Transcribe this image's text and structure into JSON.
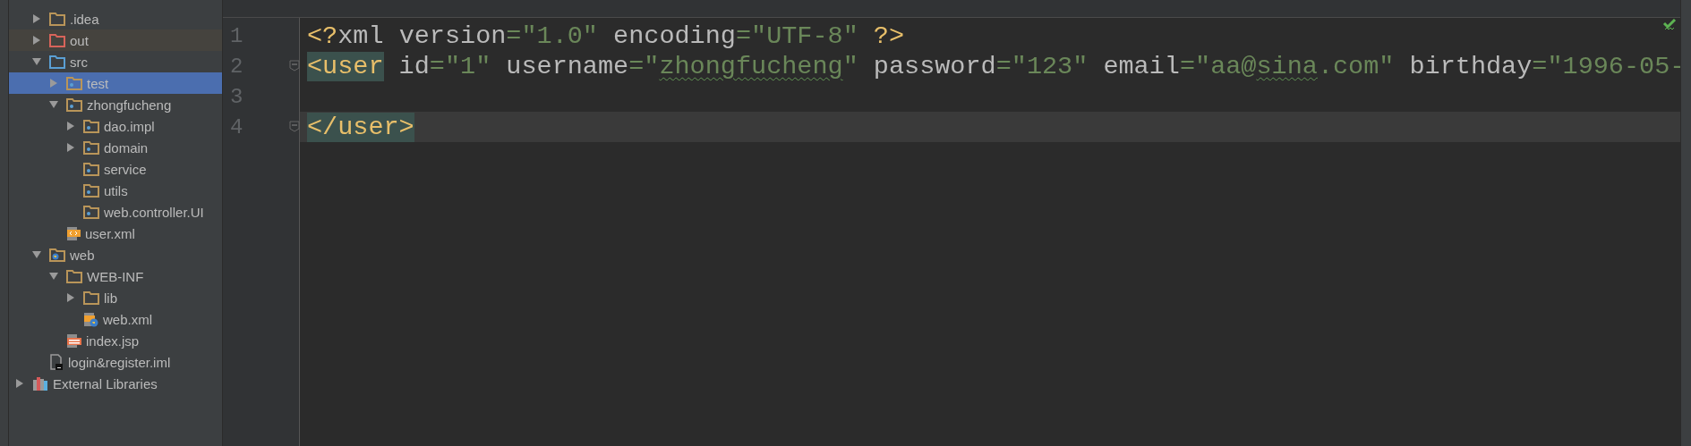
{
  "project_tree": {
    "module_items": [
      {
        "label": ".idea",
        "kind": "folder",
        "expanded": false,
        "selected": false
      },
      {
        "label": "out",
        "kind": "excluded_folder",
        "expanded": false,
        "selected": false
      },
      {
        "label": "src",
        "kind": "source_folder",
        "expanded": true,
        "selected": false,
        "children": [
          {
            "label": "test",
            "kind": "package",
            "expanded": false,
            "selected": true
          },
          {
            "label": "zhongfucheng",
            "kind": "package",
            "expanded": true,
            "selected": false,
            "children": [
              {
                "label": "dao.impl",
                "kind": "package",
                "expanded": false,
                "selected": false
              },
              {
                "label": "domain",
                "kind": "package",
                "expanded": false,
                "selected": false
              },
              {
                "label": "service",
                "kind": "package",
                "selected": false
              },
              {
                "label": "utils",
                "kind": "package",
                "selected": false
              },
              {
                "label": "web.controller.UI",
                "kind": "package",
                "selected": false
              }
            ]
          },
          {
            "label": "user.xml",
            "kind": "xml_file",
            "selected": false
          }
        ]
      },
      {
        "label": "web",
        "kind": "web_folder",
        "expanded": true,
        "selected": false,
        "children": [
          {
            "label": "WEB-INF",
            "kind": "folder",
            "expanded": true,
            "selected": false,
            "children": [
              {
                "label": "lib",
                "kind": "folder",
                "expanded": false,
                "selected": false
              },
              {
                "label": "web.xml",
                "kind": "web_xml_file",
                "selected": false
              }
            ]
          },
          {
            "label": "index.jsp",
            "kind": "jsp_file",
            "selected": false
          }
        ]
      },
      {
        "label": "login&register.iml",
        "kind": "iml_file",
        "selected": false
      }
    ],
    "external_libraries": {
      "label": "External Libraries",
      "kind": "libraries",
      "expanded": false,
      "selected": false
    }
  },
  "editor": {
    "lines": [
      {
        "number": "1",
        "current": false,
        "fold": false,
        "tokens": [
          {
            "text": "<?",
            "kind": "tag"
          },
          {
            "text": "xml version",
            "kind": "attr"
          },
          {
            "text": "=\"1.0\"",
            "kind": "value"
          },
          {
            "text": " encoding",
            "kind": "attr"
          },
          {
            "text": "=\"UTF-8\"",
            "kind": "value"
          },
          {
            "text": " ?>",
            "kind": "tag"
          }
        ]
      },
      {
        "number": "2",
        "current": false,
        "fold": true,
        "tokens": [
          {
            "text": "<user",
            "kind": "tag",
            "highlighted": true
          },
          {
            "text": " id",
            "kind": "attr"
          },
          {
            "text": "=\"1\"",
            "kind": "value"
          },
          {
            "text": " username",
            "kind": "attr"
          },
          {
            "text": "=\"",
            "kind": "value"
          },
          {
            "text": "zhongfucheng",
            "kind": "value",
            "typo": true
          },
          {
            "text": "\"",
            "kind": "value"
          },
          {
            "text": " password",
            "kind": "attr"
          },
          {
            "text": "=\"123\"",
            "kind": "value"
          },
          {
            "text": " email",
            "kind": "attr"
          },
          {
            "text": "=\"aa@",
            "kind": "value"
          },
          {
            "text": "sina",
            "kind": "value",
            "typo": true
          },
          {
            "text": ".com\"",
            "kind": "value"
          },
          {
            "text": " birthday",
            "kind": "attr"
          },
          {
            "text": "=\"1996-05-",
            "kind": "value"
          }
        ]
      },
      {
        "number": "3",
        "current": false,
        "fold": false
      },
      {
        "number": "4",
        "current": true,
        "fold": true,
        "tokens": [
          {
            "text": "</user>",
            "kind": "tag",
            "highlighted": true
          }
        ]
      }
    ]
  }
}
